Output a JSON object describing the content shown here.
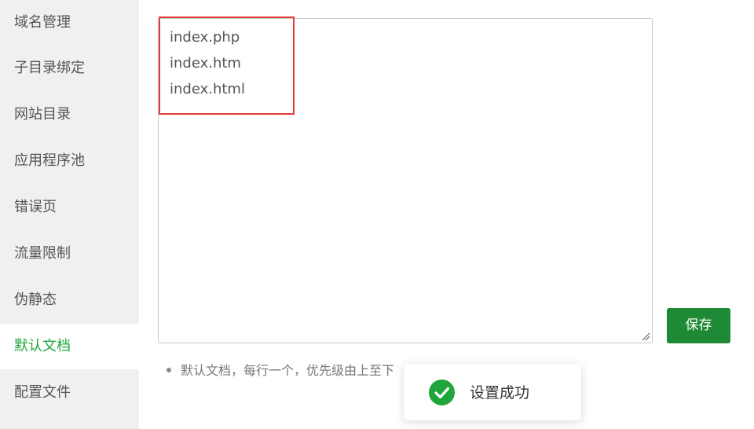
{
  "sidebar": {
    "items": [
      {
        "label": "域名管理",
        "active": false
      },
      {
        "label": "子目录绑定",
        "active": false
      },
      {
        "label": "网站目录",
        "active": false
      },
      {
        "label": "应用程序池",
        "active": false
      },
      {
        "label": "错误页",
        "active": false
      },
      {
        "label": "流量限制",
        "active": false
      },
      {
        "label": "伪静态",
        "active": false
      },
      {
        "label": "默认文档",
        "active": true
      },
      {
        "label": "配置文件",
        "active": false
      }
    ]
  },
  "editor": {
    "lines": [
      "index.php",
      "index.htm",
      "index.html"
    ]
  },
  "save_label": "保存",
  "hint": "默认文档，每行一个，优先级由上至下",
  "toast": {
    "text": "设置成功",
    "icon": "check-circle-icon"
  },
  "colors": {
    "accent": "#20a53a",
    "save_button": "#1e8a35",
    "highlight": "#e53935",
    "toast_icon": "#20a53a"
  }
}
